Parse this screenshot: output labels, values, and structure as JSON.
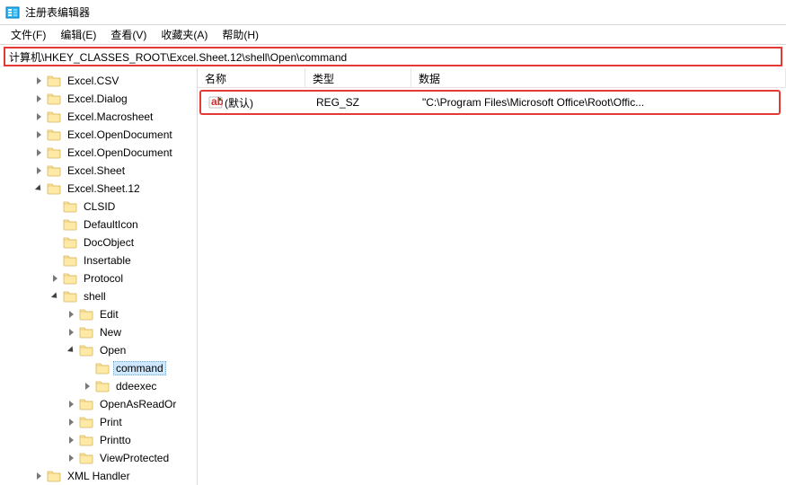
{
  "window": {
    "title": "注册表编辑器"
  },
  "menu": {
    "file": "文件(F)",
    "edit": "编辑(E)",
    "view": "查看(V)",
    "favorites": "收藏夹(A)",
    "help": "帮助(H)"
  },
  "address": "计算机\\HKEY_CLASSES_ROOT\\Excel.Sheet.12\\shell\\Open\\command",
  "columns": {
    "name": "名称",
    "type": "类型",
    "data": "数据"
  },
  "values": [
    {
      "name": "(默认)",
      "type": "REG_SZ",
      "data": "\"C:\\Program Files\\Microsoft Office\\Root\\Offic..."
    }
  ],
  "tree": {
    "items": [
      {
        "depth": 2,
        "exp": "closed",
        "label": "Excel.CSV"
      },
      {
        "depth": 2,
        "exp": "closed",
        "label": "Excel.Dialog"
      },
      {
        "depth": 2,
        "exp": "closed",
        "label": "Excel.Macrosheet"
      },
      {
        "depth": 2,
        "exp": "closed",
        "label": "Excel.OpenDocument"
      },
      {
        "depth": 2,
        "exp": "closed",
        "label": "Excel.OpenDocument"
      },
      {
        "depth": 2,
        "exp": "closed",
        "label": "Excel.Sheet"
      },
      {
        "depth": 2,
        "exp": "open",
        "label": "Excel.Sheet.12"
      },
      {
        "depth": 3,
        "exp": "none",
        "label": "CLSID"
      },
      {
        "depth": 3,
        "exp": "none",
        "label": "DefaultIcon"
      },
      {
        "depth": 3,
        "exp": "none",
        "label": "DocObject"
      },
      {
        "depth": 3,
        "exp": "none",
        "label": "Insertable"
      },
      {
        "depth": 3,
        "exp": "closed",
        "label": "Protocol"
      },
      {
        "depth": 3,
        "exp": "open",
        "label": "shell"
      },
      {
        "depth": 4,
        "exp": "closed",
        "label": "Edit"
      },
      {
        "depth": 4,
        "exp": "closed",
        "label": "New"
      },
      {
        "depth": 4,
        "exp": "open",
        "label": "Open"
      },
      {
        "depth": 5,
        "exp": "none",
        "label": "command",
        "selected": true
      },
      {
        "depth": 5,
        "exp": "closed",
        "label": "ddeexec"
      },
      {
        "depth": 4,
        "exp": "closed",
        "label": "OpenAsReadOr"
      },
      {
        "depth": 4,
        "exp": "closed",
        "label": "Print"
      },
      {
        "depth": 4,
        "exp": "closed",
        "label": "Printto"
      },
      {
        "depth": 4,
        "exp": "closed",
        "label": "ViewProtected"
      },
      {
        "depth": 2,
        "exp": "closed",
        "label": "XML Handler"
      }
    ]
  }
}
